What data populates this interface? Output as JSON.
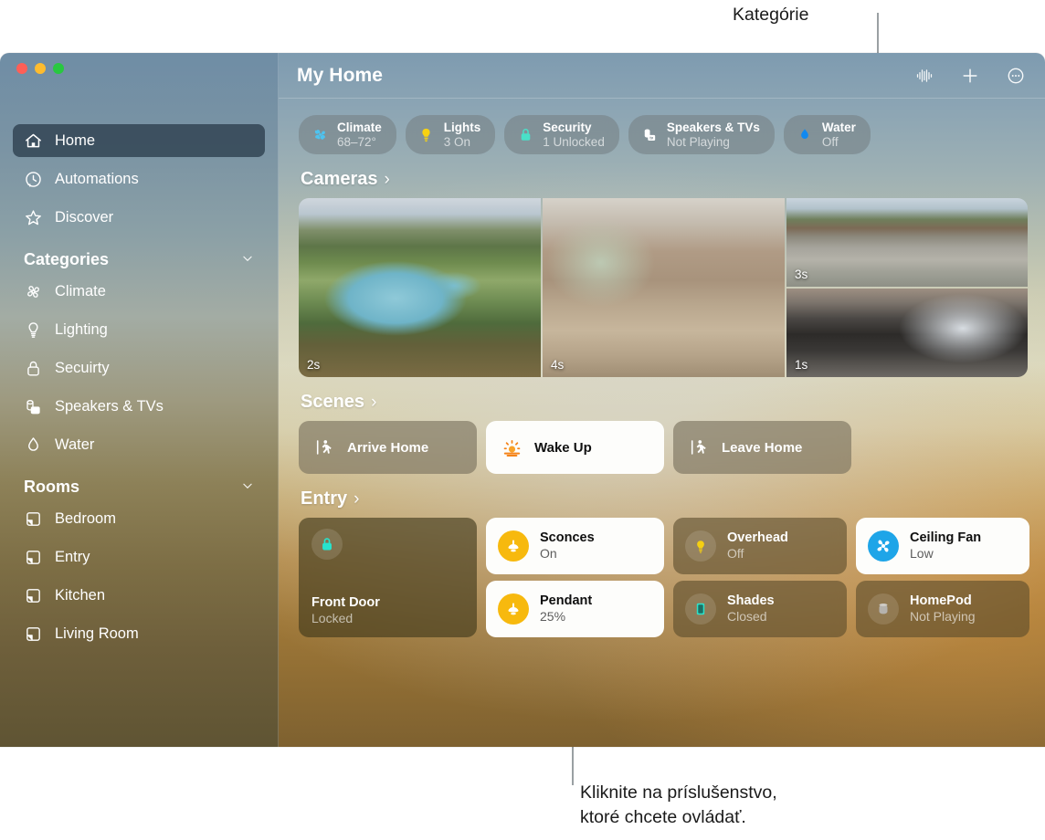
{
  "annotations": {
    "top": "Kategórie",
    "bottom": "Kliknite na príslušenstvo,\nktoré chcete ovládať."
  },
  "window": {
    "traffic_lights": [
      "close",
      "minimize",
      "zoom"
    ]
  },
  "sidebar": {
    "nav": [
      {
        "label": "Home",
        "icon": "house-icon",
        "selected": true
      },
      {
        "label": "Automations",
        "icon": "clock-icon",
        "selected": false
      },
      {
        "label": "Discover",
        "icon": "star-icon",
        "selected": false
      }
    ],
    "groups": [
      {
        "title": "Categories",
        "chevron": "chevron-down-icon",
        "items": [
          {
            "label": "Climate",
            "icon": "fan-icon"
          },
          {
            "label": "Lighting",
            "icon": "bulb-icon"
          },
          {
            "label": "Secuirty",
            "icon": "lock-icon"
          },
          {
            "label": "Speakers & TVs",
            "icon": "speaker-tv-icon"
          },
          {
            "label": "Water",
            "icon": "droplet-icon"
          }
        ]
      },
      {
        "title": "Rooms",
        "chevron": "chevron-down-icon",
        "items": [
          {
            "label": "Bedroom",
            "icon": "room-icon"
          },
          {
            "label": "Entry",
            "icon": "room-icon"
          },
          {
            "label": "Kitchen",
            "icon": "room-icon"
          },
          {
            "label": "Living Room",
            "icon": "room-icon"
          }
        ]
      }
    ]
  },
  "toolbar": {
    "title": "My Home",
    "actions": [
      {
        "name": "siri-waveform-icon"
      },
      {
        "name": "add-icon"
      },
      {
        "name": "more-options-icon"
      }
    ]
  },
  "status_pills": [
    {
      "title": "Climate",
      "subtitle": "68–72°",
      "icon": "fan-icon",
      "color": "#4ec3ef"
    },
    {
      "title": "Lights",
      "subtitle": "3 On",
      "icon": "bulb-icon",
      "color": "#f7d211"
    },
    {
      "title": "Security",
      "subtitle": "1 Unlocked",
      "icon": "lock-icon",
      "color": "#4ae0c8"
    },
    {
      "title": "Speakers & TVs",
      "subtitle": "Not Playing",
      "icon": "speaker-tv-icon",
      "color": "#ffffff"
    },
    {
      "title": "Water",
      "subtitle": "Off",
      "icon": "droplet-icon",
      "color": "#1289f0"
    }
  ],
  "sections": {
    "cameras": {
      "title": "Cameras",
      "chevron": "›"
    },
    "scenes": {
      "title": "Scenes",
      "chevron": "›"
    },
    "entry": {
      "title": "Entry",
      "chevron": "›"
    }
  },
  "cameras": [
    {
      "name": "pool-camera",
      "timestamp": "2s",
      "art": "cam-pool"
    },
    {
      "name": "driveway-camera",
      "timestamp": "3s",
      "art": "cam-drive"
    },
    {
      "name": "garage-camera",
      "timestamp": "1s",
      "art": "cam-garage"
    },
    {
      "name": "living-room-camera",
      "timestamp": "4s",
      "art": "cam-living"
    }
  ],
  "scenes": [
    {
      "label": "Arrive Home",
      "icon": "walk-in-icon",
      "active": false
    },
    {
      "label": "Wake Up",
      "icon": "sunrise-icon",
      "active": true
    },
    {
      "label": "Leave Home",
      "icon": "walk-out-icon",
      "active": false
    }
  ],
  "accessories": [
    {
      "name": "Front Door",
      "state": "Locked",
      "icon": "lock-icon",
      "icon_style": "plain",
      "on": false,
      "tall": true
    },
    {
      "name": "Sconces",
      "state": "On",
      "icon": "sconce-icon",
      "icon_style": "yellow",
      "on": true,
      "tall": false
    },
    {
      "name": "Overhead",
      "state": "Off",
      "icon": "bulb-icon",
      "icon_style": "plain",
      "on": false,
      "tall": false
    },
    {
      "name": "Ceiling Fan",
      "state": "Low",
      "icon": "fan-icon",
      "icon_style": "blue",
      "on": true,
      "tall": false
    },
    {
      "name": "Pendant",
      "state": "25%",
      "icon": "sconce-icon",
      "icon_style": "yellow",
      "on": true,
      "tall": false
    },
    {
      "name": "Shades",
      "state": "Closed",
      "icon": "shades-icon",
      "icon_style": "plain",
      "on": false,
      "tall": false
    },
    {
      "name": "HomePod",
      "state": "Not Playing",
      "icon": "homepod-icon",
      "icon_style": "plain",
      "on": false,
      "tall": false
    }
  ]
}
